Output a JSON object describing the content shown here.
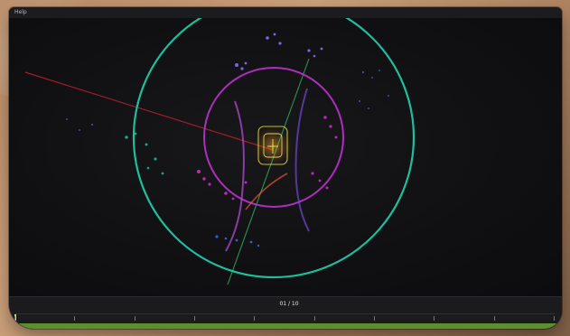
{
  "window": {
    "menu": [
      "Help"
    ]
  },
  "timeline": {
    "frame_counter": "01 / 10",
    "current_index": 1,
    "total_frames": 10,
    "left_status": "",
    "right_status": ""
  },
  "colors": {
    "ring_outer": "#1fc7a6",
    "ring_inner": "#b52fc6",
    "axis_red": "#b61f2f",
    "axis_green": "#2fbf6a",
    "accent_green": "#5e8f2f"
  },
  "icons": {
    "vehicle": "car-icon"
  }
}
